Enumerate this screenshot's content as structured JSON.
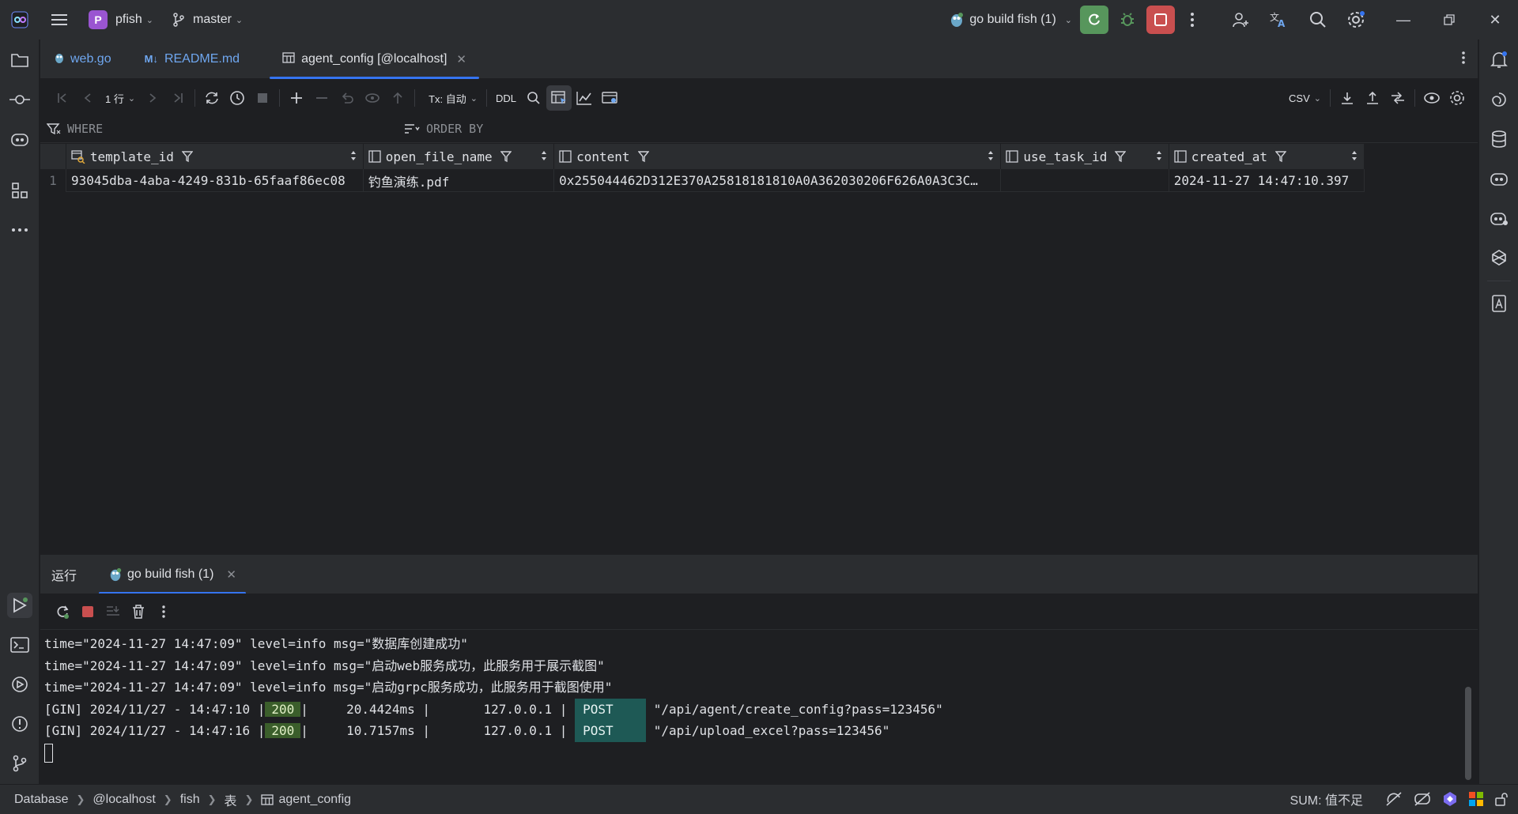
{
  "titlebar": {
    "project_badge": "P",
    "project_name": "pfish",
    "branch": "master",
    "run_config": "go build fish (1)"
  },
  "tabs": [
    {
      "label": "web.go",
      "icon": "go-file-icon"
    },
    {
      "label": "README.md",
      "icon": "markdown-icon"
    },
    {
      "label": "agent_config [@localhost]",
      "icon": "table-icon"
    }
  ],
  "grid_toolbar": {
    "page_size": "1 行",
    "tx_mode": "Tx: 自动",
    "ddl_label": "DDL",
    "export_format": "CSV"
  },
  "filter": {
    "where_label": "WHERE",
    "order_label": "ORDER BY"
  },
  "table": {
    "columns": [
      {
        "name": "template_id",
        "icon": "primary-key-icon"
      },
      {
        "name": "open_file_name",
        "icon": "column-icon"
      },
      {
        "name": "content",
        "icon": "column-icon"
      },
      {
        "name": "use_task_id",
        "icon": "column-icon"
      },
      {
        "name": "created_at",
        "icon": "column-icon"
      }
    ],
    "rows": [
      {
        "num": "1",
        "cells": [
          "93045dba-4aba-4249-831b-65faaf86ec08",
          "钓鱼演练.pdf",
          "0x255044462D312E370A25818181810A0A362030206F626A0A3C3C…",
          "",
          "2024-11-27 14:47:10.397"
        ]
      }
    ]
  },
  "run_panel": {
    "title": "运行",
    "tab_label": "go build fish (1)",
    "console": [
      "time=\"2024-11-27 14:47:09\" level=info msg=\"数据库创建成功\"",
      "time=\"2024-11-27 14:47:09\" level=info msg=\"启动web服务成功，此服务用于展示截图\"",
      "time=\"2024-11-27 14:47:09\" level=info msg=\"启动grpc服务成功，此服务用于截图使用\""
    ],
    "gin_logs": [
      {
        "prefix": "[GIN] 2024/11/27 - 14:47:10 |",
        "status": "200",
        "latency": "|     20.4424ms |       127.0.0.1 |",
        "method": "POST",
        "path": "\"/api/agent/create_config?pass=123456\""
      },
      {
        "prefix": "[GIN] 2024/11/27 - 14:47:16 |",
        "status": "200",
        "latency": "|     10.7157ms |       127.0.0.1 |",
        "method": "POST",
        "path": "\"/api/upload_excel?pass=123456\""
      }
    ]
  },
  "statusbar": {
    "breadcrumbs": [
      "Database",
      "@localhost",
      "fish",
      "表",
      "agent_config"
    ],
    "sum": "SUM: 值不足"
  },
  "colors": {
    "accent": "#3574f0",
    "run_green": "#57965c",
    "stop_red": "#c94f4f",
    "status_200_bg": "#3b5e2b",
    "post_bg": "#1e5955"
  }
}
